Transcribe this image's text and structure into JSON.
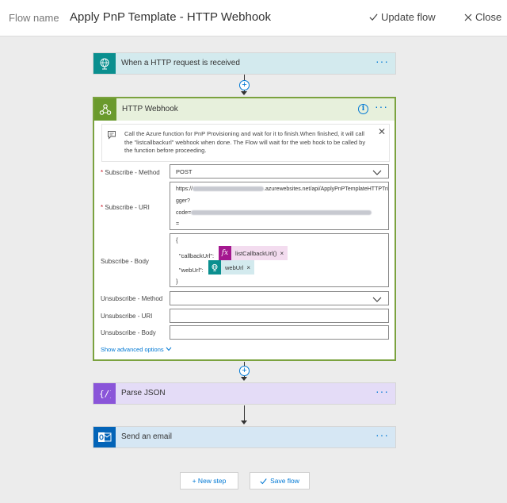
{
  "header": {
    "flow_name_label": "Flow name",
    "flow_title": "Apply PnP Template - HTTP Webhook",
    "update_flow": "Update flow",
    "close": "Close"
  },
  "trigger": {
    "title": "When a HTTP request is received",
    "icon": "globe-icon",
    "more": "···"
  },
  "webhook": {
    "title": "HTTP Webhook",
    "icon": "webhook-icon",
    "more": "···",
    "description": "Call the Azure function for PnP Provisioning and wait for it to finish.When finished, it will call the \"listcallbackurl\" webhook when done. The Flow will wait for the web hook to be called by the function before proceeding.",
    "fields": {
      "sub_method_label": "Subscribe - Method",
      "sub_method_value": "POST",
      "sub_uri_label": "Subscribe - URI",
      "sub_uri_line1_prefix": "https://",
      "sub_uri_line1_suffix": ".azurewebsites.net/api/ApplyPnPTemplateHTTPTri",
      "sub_uri_line2": "gger?",
      "sub_uri_line3_prefix": "code=",
      "sub_uri_line4": "=",
      "sub_body_label": "Subscribe - Body",
      "body_open": "{",
      "body_callback_key": "\"callbackUrl\":",
      "body_callback_token": "listCallbackUrl()",
      "body_web_key": "\"webUrl\":",
      "body_web_token": "webUrl",
      "body_close": "}",
      "token_remove": "×",
      "unsub_method_label": "Unsubscribe - Method",
      "unsub_uri_label": "Unsubscribe - URI",
      "unsub_body_label": "Unsubscribe - Body",
      "required_mark": "*"
    },
    "advanced_options": "Show advanced options"
  },
  "parse_json": {
    "title": "Parse JSON",
    "icon": "braces-icon",
    "more": "···"
  },
  "send_email": {
    "title": "Send an email",
    "icon": "outlook-icon",
    "more": "···"
  },
  "buttons": {
    "new_step": "+ New step",
    "save_flow": "Save flow"
  },
  "colors": {
    "accent": "#0078d4",
    "webhook_border": "#7ba23f",
    "trigger_bg": "#d3eaee",
    "parse_bg": "#e4dcf7",
    "email_bg": "#d6e7f4"
  }
}
